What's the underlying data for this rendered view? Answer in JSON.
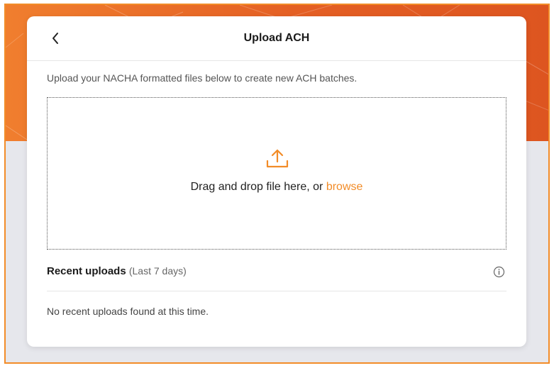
{
  "header": {
    "title": "Upload ACH",
    "back_icon": "chevron-left-icon"
  },
  "description": "Upload your NACHA formatted files below to create new ACH batches.",
  "dropzone": {
    "icon": "upload-icon",
    "prompt": "Drag and drop file here, or",
    "browse_label": "browse"
  },
  "recent_uploads": {
    "title": "Recent uploads",
    "range": "(Last 7 days)",
    "info_icon": "info-icon",
    "empty_message": "No recent uploads found at this time."
  },
  "colors": {
    "accent": "#f28c28",
    "hero": "#e45f24",
    "background": "#e6e7ec"
  }
}
